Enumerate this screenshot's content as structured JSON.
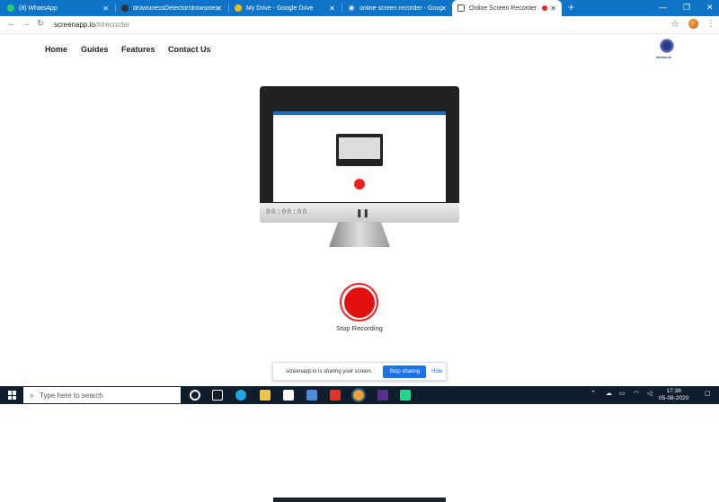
{
  "browser": {
    "tabs": [
      {
        "title": "(8) WhatsApp",
        "color": "#25d366"
      },
      {
        "title": "drowsinessDetector/drowsinessD",
        "color": "#333333"
      },
      {
        "title": "My Drive - Google Drive",
        "color": "#fbbc04"
      },
      {
        "title": "online screen recorder - Google",
        "color": "#4285f4"
      },
      {
        "title": "Online Screen Recorder",
        "color": "#555555"
      }
    ],
    "new_tab_label": "+",
    "url_host": "screenapp.io",
    "url_path": "/#/recorder"
  },
  "site": {
    "nav": [
      "Home",
      "Guides",
      "Features",
      "Contact Us"
    ],
    "logo_text": "webco.ai"
  },
  "recorder": {
    "timer": "00:00:00",
    "stop_label": "Stop Recording"
  },
  "share_bar": {
    "text": "screenapp.io is sharing your screen.",
    "stop_button": "Stop sharing",
    "hide_link": "Hide"
  },
  "taskbar": {
    "search_placeholder": "Type here to search",
    "time": "17:38",
    "date": "05-08-2020"
  },
  "colors": {
    "chrome_blue": "#0f74c7",
    "record_red": "#e41010",
    "accent_blue": "#1a73e8"
  }
}
